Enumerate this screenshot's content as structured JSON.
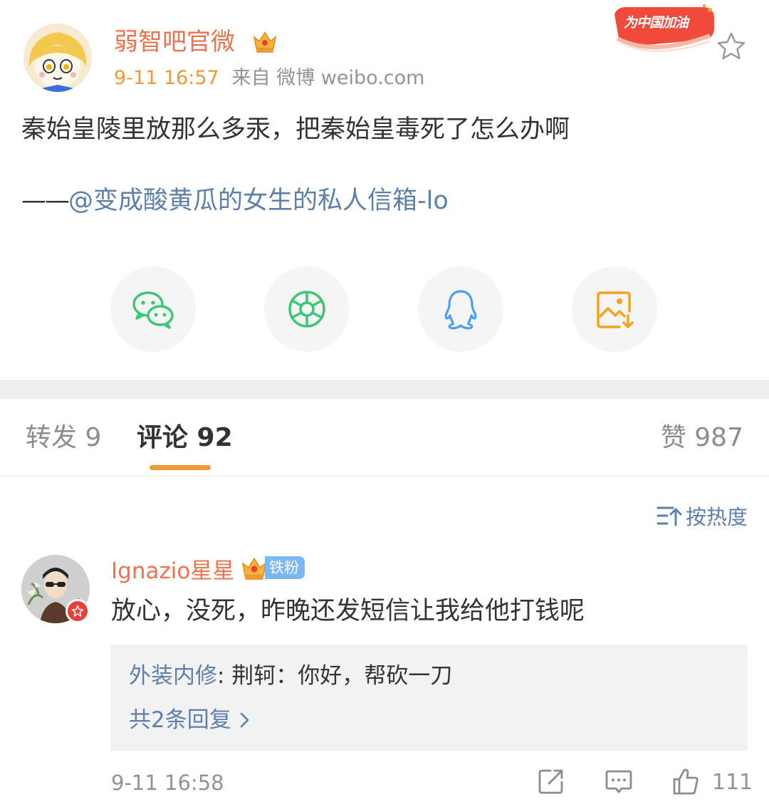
{
  "post": {
    "author": "弱智吧官微",
    "time": "9-11 16:57",
    "source": "来自 微博 weibo.com",
    "badge_text": "为中国加油",
    "text": "秦始皇陵里放那么多汞，把秦始皇毒死了怎么办啊",
    "credit_dash": "——",
    "credit_link": "@变成酸黄瓜的女生的私人信箱-lo"
  },
  "share": [
    {
      "icon": "wechat-icon",
      "color": "#3dc774"
    },
    {
      "icon": "moments-icon",
      "color": "#3dc774"
    },
    {
      "icon": "qq-icon",
      "color": "#4a9ff5"
    },
    {
      "icon": "save-image-icon",
      "color": "#f7a21b"
    }
  ],
  "tabs": {
    "repost": "转发 9",
    "comment": "评论 92",
    "like": "赞 987"
  },
  "sort": {
    "label": "按热度"
  },
  "comment": {
    "user": "Ignazio星星",
    "fan_tag": "铁粉",
    "text": "放心，没死，昨晚还发短信让我给他打钱呢",
    "reply_user": "外装内修",
    "reply_text": ": 荆轲：你好，帮砍一刀",
    "reply_more": "共2条回复",
    "time": "9-11 16:58",
    "likes": "111"
  },
  "colors": {
    "accent": "#f09a36",
    "username": "#eb7350",
    "link": "#5d7fa8"
  }
}
